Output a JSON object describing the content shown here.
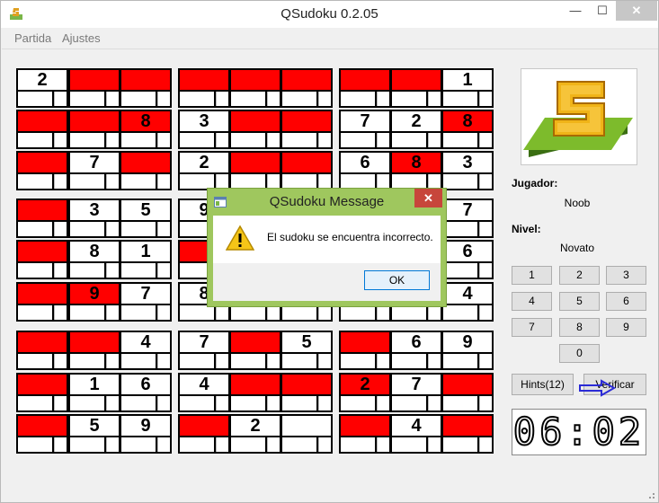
{
  "window": {
    "title": "QSudoku 0.2.05",
    "min_label": "—",
    "max_label": "☐",
    "close_label": "✕"
  },
  "menu": {
    "items": [
      "Partida",
      "Ajustes"
    ]
  },
  "board": {
    "rows": [
      [
        [
          "2",
          "w"
        ],
        [
          "",
          "r"
        ],
        [
          "",
          "r"
        ],
        [
          "",
          "r"
        ],
        [
          "",
          "r"
        ],
        [
          "",
          "r"
        ],
        [
          "",
          "r"
        ],
        [
          "",
          "r"
        ],
        [
          "1",
          "w"
        ]
      ],
      [
        [
          "",
          "r"
        ],
        [
          "",
          "r"
        ],
        [
          "8",
          "r"
        ],
        [
          "3",
          "w"
        ],
        [
          "",
          "r"
        ],
        [
          "",
          "r"
        ],
        [
          "7",
          "w"
        ],
        [
          "2",
          "w"
        ],
        [
          "8",
          "r"
        ]
      ],
      [
        [
          "",
          "r"
        ],
        [
          "7",
          "w"
        ],
        [
          "",
          "r"
        ],
        [
          "2",
          "w"
        ],
        [
          "",
          "r"
        ],
        [
          "",
          "r"
        ],
        [
          "6",
          "w"
        ],
        [
          "8",
          "r"
        ],
        [
          "3",
          "w"
        ]
      ],
      [
        [
          "",
          "r"
        ],
        [
          "3",
          "w"
        ],
        [
          "5",
          "w"
        ],
        [
          "9",
          "w"
        ],
        [
          "",
          "w"
        ],
        [
          "",
          "w"
        ],
        [
          "",
          "w"
        ],
        [
          "",
          "w"
        ],
        [
          "7",
          "w"
        ]
      ],
      [
        [
          "",
          "r"
        ],
        [
          "8",
          "w"
        ],
        [
          "1",
          "w"
        ],
        [
          "",
          "r"
        ],
        [
          "",
          "w"
        ],
        [
          "",
          "w"
        ],
        [
          "",
          "w"
        ],
        [
          "",
          "w"
        ],
        [
          "6",
          "w"
        ]
      ],
      [
        [
          "",
          "r"
        ],
        [
          "9",
          "r"
        ],
        [
          "7",
          "w"
        ],
        [
          "8",
          "w"
        ],
        [
          "",
          "w"
        ],
        [
          "",
          "w"
        ],
        [
          "",
          "w"
        ],
        [
          "",
          "w"
        ],
        [
          "4",
          "w"
        ]
      ],
      [
        [
          "",
          "r"
        ],
        [
          "",
          "r"
        ],
        [
          "4",
          "w"
        ],
        [
          "7",
          "w"
        ],
        [
          "",
          "r"
        ],
        [
          "5",
          "w"
        ],
        [
          "",
          "r"
        ],
        [
          "6",
          "w"
        ],
        [
          "9",
          "w"
        ]
      ],
      [
        [
          "",
          "r"
        ],
        [
          "1",
          "w"
        ],
        [
          "6",
          "w"
        ],
        [
          "4",
          "w"
        ],
        [
          "",
          "r"
        ],
        [
          "",
          "r"
        ],
        [
          "2",
          "r"
        ],
        [
          "7",
          "w"
        ],
        [
          "",
          "r"
        ]
      ],
      [
        [
          "",
          "r"
        ],
        [
          "5",
          "w"
        ],
        [
          "9",
          "w"
        ],
        [
          "",
          "r"
        ],
        [
          "2",
          "w"
        ],
        [
          "",
          "w"
        ],
        [
          "",
          "r"
        ],
        [
          "4",
          "w"
        ],
        [
          "",
          "r"
        ]
      ]
    ]
  },
  "sidebar": {
    "player_label": "Jugador:",
    "player_value": "Noob",
    "level_label": "Nivel:",
    "level_value": "Novato",
    "numbers": [
      "1",
      "2",
      "3",
      "4",
      "5",
      "6",
      "7",
      "8",
      "9",
      "0"
    ],
    "hints_label": "Hints(12)",
    "verify_label": "Verificar",
    "clock": "06:02"
  },
  "dialog": {
    "title": "QSudoku Message",
    "message": "El sudoku se encuentra incorrecto.",
    "ok_label": "OK",
    "close_label": "✕"
  },
  "colors": {
    "red_cell": "#ff0000",
    "dialog_frame": "#9fc75e",
    "arrow": "#2b2bd6"
  }
}
